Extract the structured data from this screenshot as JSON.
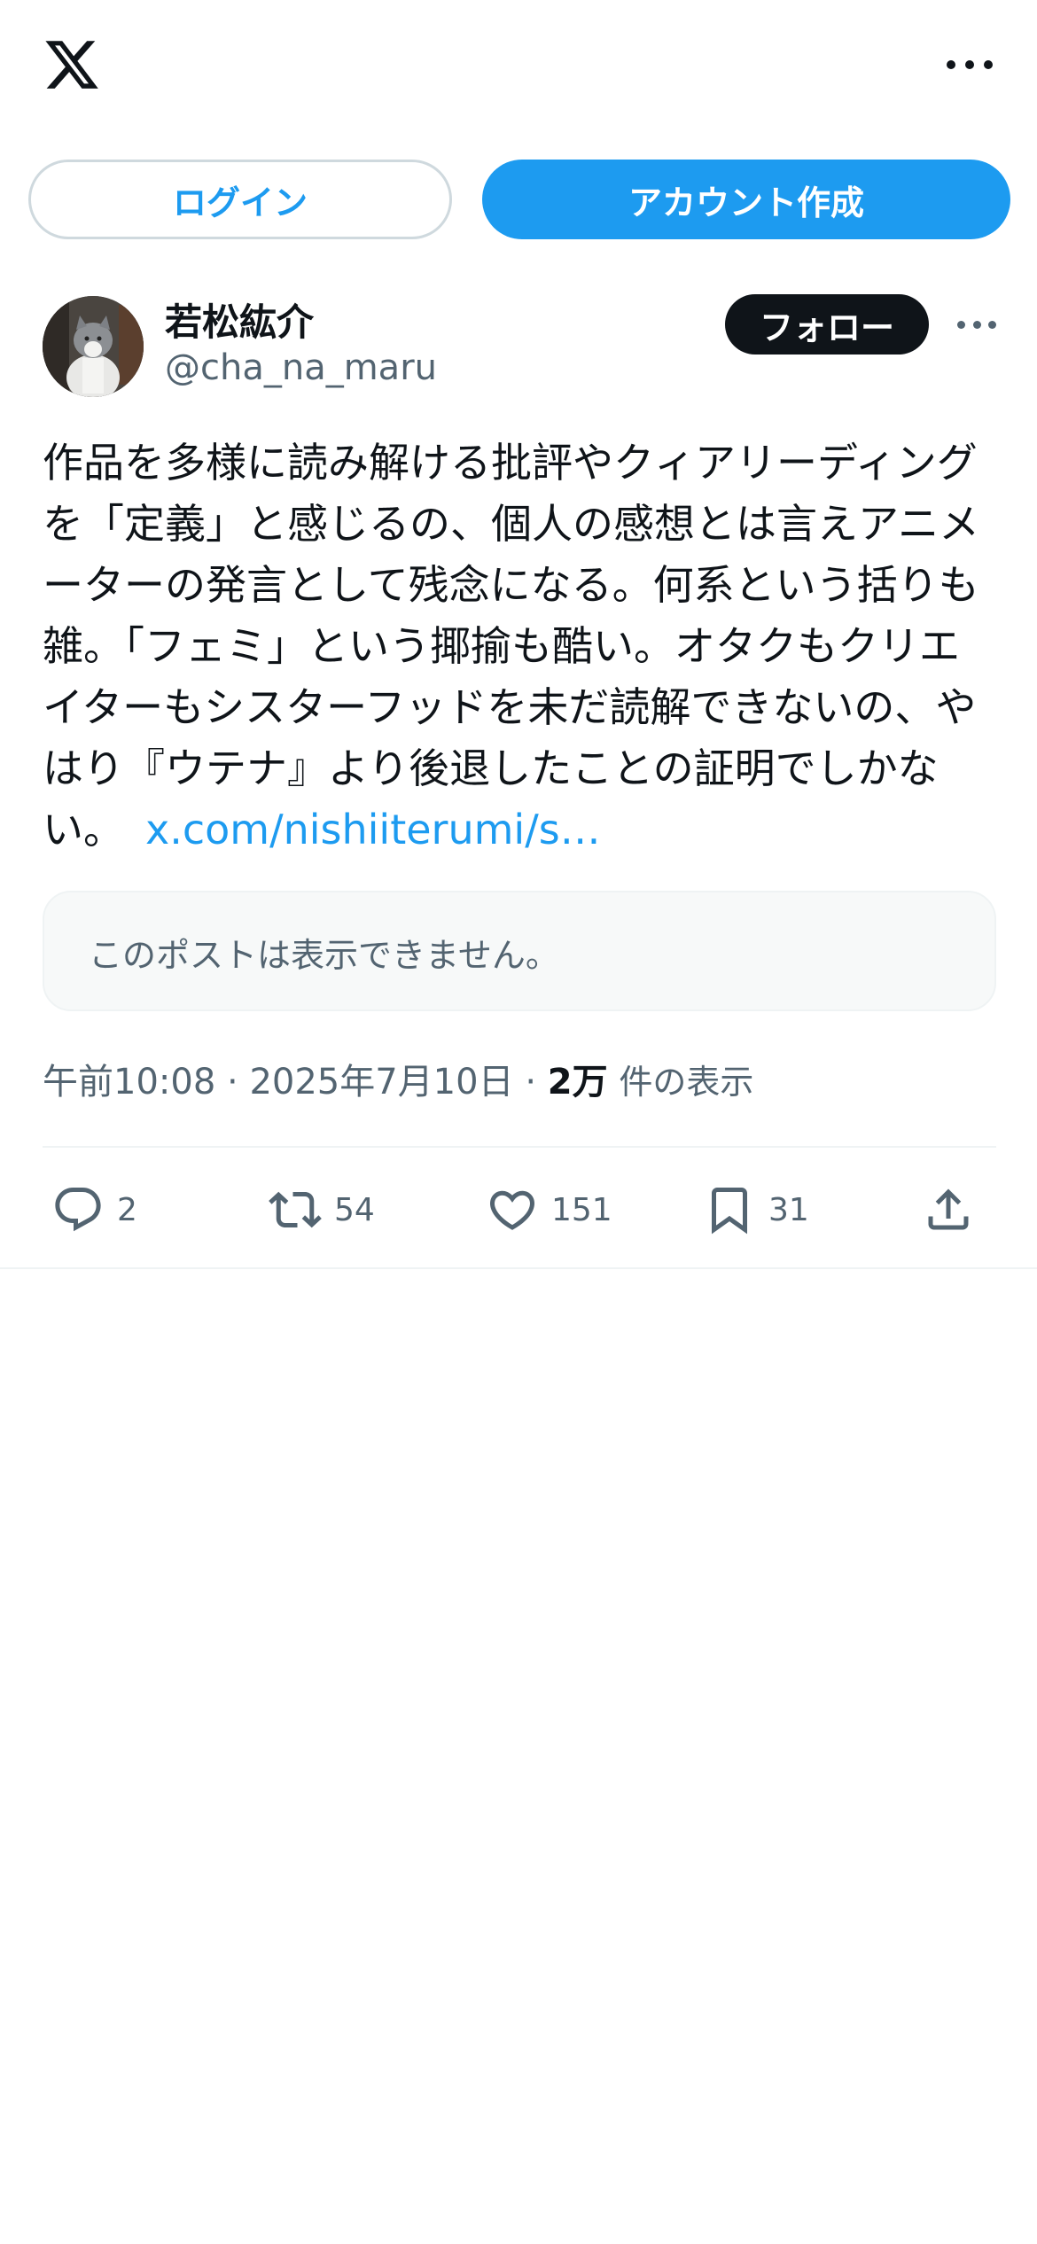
{
  "header": {
    "logo_icon": "x-logo-icon",
    "more_icon": "more-horizontal-icon"
  },
  "auth": {
    "login_label": "ログイン",
    "signup_label": "アカウント作成"
  },
  "post": {
    "display_name": "若松紘介",
    "handle": "@cha_na_maru",
    "follow_label": "フォロー",
    "text": "作品を多様に読み解ける批評やクィアリーディングを「定義」と感じるの、個人の感想とは言えアニメーターの発言として残念になる。何系という括りも雑。「フェミ」という揶揄も酷い。オタクもクリエイターもシスターフッドを未だ読解できないの、やはり『ウテナ』より後退したことの証明でしかない。",
    "link_text": "x.com/nishiiterumi/s…",
    "unavailable_text": "このポストは表示できません。",
    "time": "午前10:08",
    "date": "2025年7月10日",
    "separator": "·",
    "views_count": "2万",
    "views_label": "件の表示"
  },
  "actions": {
    "replies": "2",
    "reposts": "54",
    "likes": "151",
    "bookmarks": "31"
  },
  "colors": {
    "accent": "#1d9bf0",
    "text": "#0f1419",
    "secondary": "#536471",
    "border": "#eff3f4"
  }
}
